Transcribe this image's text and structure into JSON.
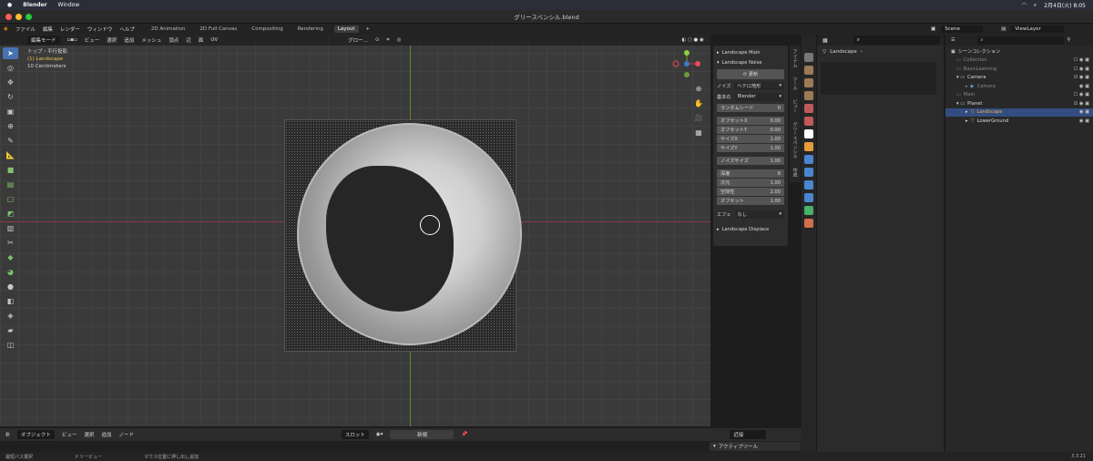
{
  "mac": {
    "app": "Blender",
    "menu": "Window",
    "clock": "2月4日(火)  8:05"
  },
  "window": {
    "title": "グリースペンシル.blend"
  },
  "topbar": {
    "menus": [
      "ファイル",
      "編集",
      "レンダー",
      "ウィンドウ",
      "ヘルプ"
    ],
    "tabs": [
      "2D Animation",
      "2D Full Canvas",
      "Compositing",
      "Rendering",
      "Layout"
    ],
    "active_tab": "Layout",
    "scene": "Scene",
    "view_layer": "ViewLayer"
  },
  "viewport": {
    "mode": "編集モード",
    "menus": [
      "ビュー",
      "選択",
      "追加",
      "メッシュ",
      "頂点",
      "辺",
      "面",
      "UV"
    ],
    "transform": "グロー...",
    "info": {
      "view": "トップ・平行投影",
      "selection": "(1) Landscape",
      "scale": "10 Centimeters"
    }
  },
  "npanel": {
    "sec_main": "Landscape Main",
    "sec_noise": "Landscape Noise",
    "refresh": "更新",
    "noise_label": "ノイズ",
    "noise_type": "ヘテロ地形",
    "basis_label": "基本の",
    "basis": "Blender",
    "rows_a": [
      {
        "k": "ランダムシード",
        "v": "0"
      }
    ],
    "rows_b": [
      {
        "k": "オフセットX",
        "v": "0.00"
      },
      {
        "k": "オフセットY",
        "v": "0.00"
      },
      {
        "k": "サイズX",
        "v": "1.00"
      },
      {
        "k": "サイズY",
        "v": "1.00"
      }
    ],
    "rows_c": [
      {
        "k": "ノイズサイズ",
        "v": "1.00"
      }
    ],
    "rows_d": [
      {
        "k": "深度",
        "v": "8"
      },
      {
        "k": "次元",
        "v": "1.00"
      },
      {
        "k": "空隙性",
        "v": "2.00"
      },
      {
        "k": "オフセット",
        "v": "1.00"
      }
    ],
    "effect_label": "エフェ",
    "effect": "なし",
    "sec_displace": "Landscape Displace",
    "tabs": [
      "アイテム",
      "ツール",
      "ビュー",
      "グリースペンシル",
      "作成"
    ]
  },
  "props": {
    "title": "Landscape"
  },
  "outliner": {
    "root": "シーンコレクション",
    "rows": [
      {
        "label": "Collection",
        "indent": 1
      },
      {
        "label": "BasicLearning",
        "indent": 1
      },
      {
        "label": "Camera",
        "indent": 1
      },
      {
        "label": "Camera",
        "indent": 2
      },
      {
        "label": "Main",
        "indent": 1
      },
      {
        "label": "Planet",
        "indent": 1
      },
      {
        "label": "Landscape",
        "indent": 2
      },
      {
        "label": "LowerGround",
        "indent": 2
      }
    ],
    "selected": "Landscape"
  },
  "bottom": {
    "mode": "オブジェクト",
    "menus": [
      "ビュー",
      "選択",
      "追加",
      "ノード"
    ],
    "slot": "スロット",
    "new": "新規",
    "near": "近接",
    "active_tool": "アクティブツール"
  },
  "status": {
    "items": [
      "最短パス選択",
      "ドリービュー",
      "マウス位置に押し出し追加"
    ],
    "version": "3.3.21"
  }
}
